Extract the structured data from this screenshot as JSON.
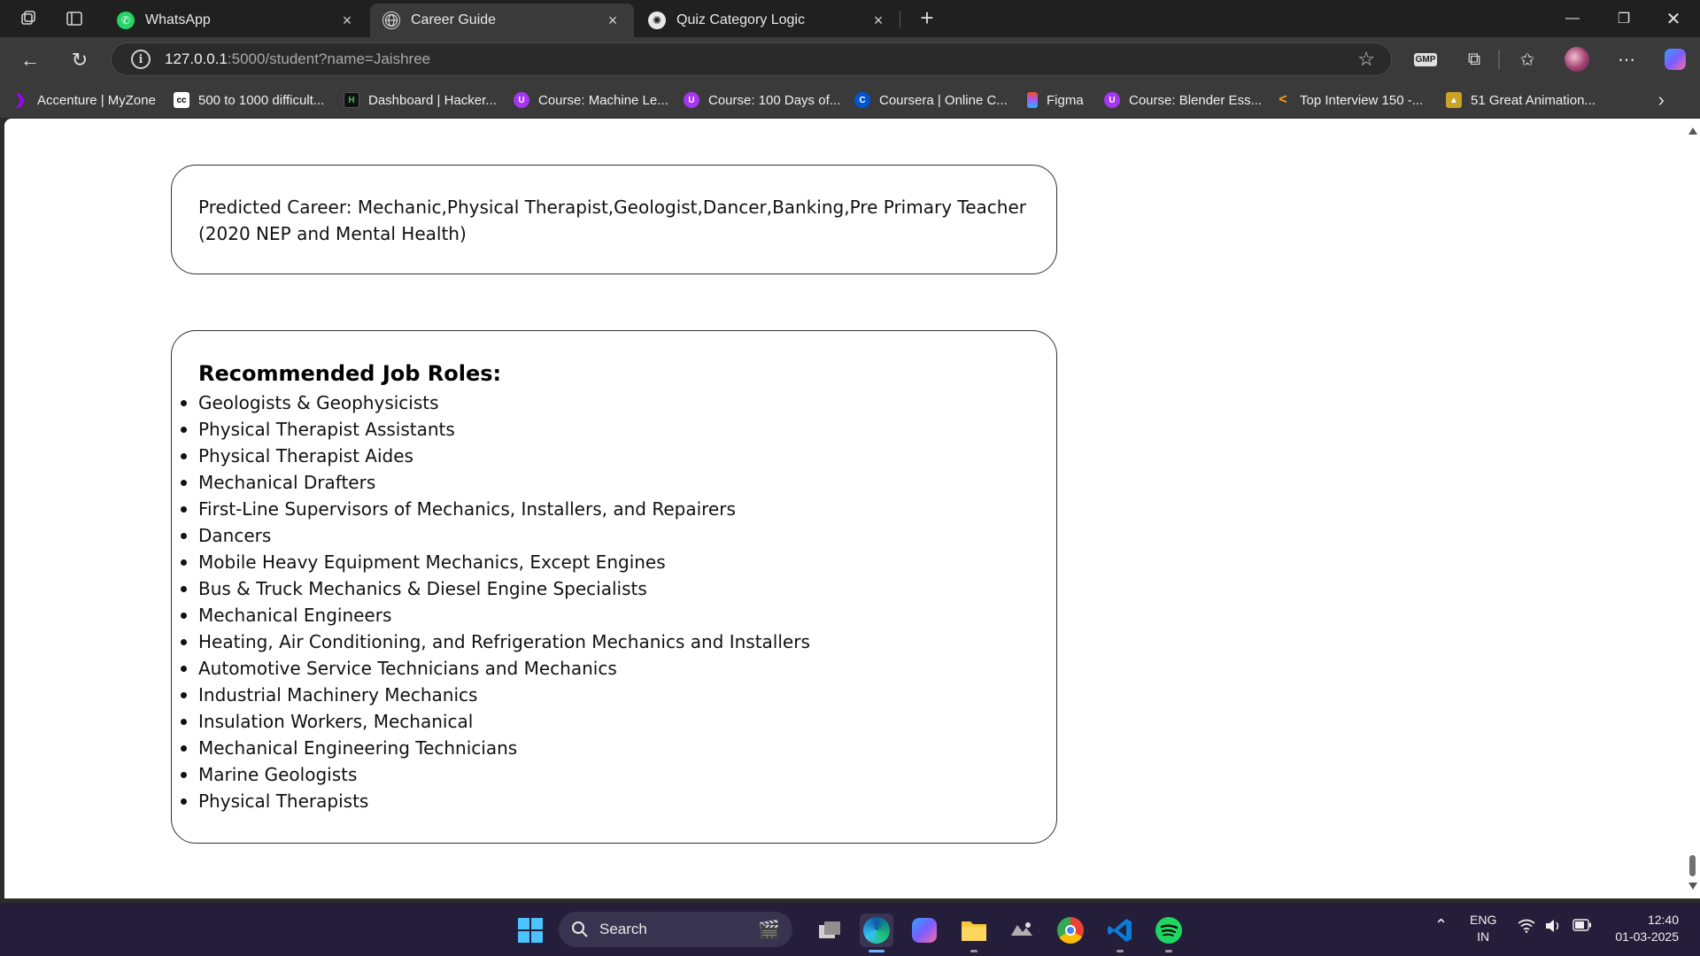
{
  "tabs": [
    {
      "label": "WhatsApp",
      "icon": "whatsapp-icon",
      "active": false
    },
    {
      "label": "Career Guide",
      "icon": "globe-icon",
      "active": true
    },
    {
      "label": "Quiz Category Logic",
      "icon": "chatgpt-icon",
      "active": false
    }
  ],
  "address": {
    "host": "127.0.0.1",
    "rest": ":5000/student?name=Jaishree"
  },
  "toolbar": {
    "gmp_label": "GMP"
  },
  "bookmarks": [
    {
      "label": "Accenture | MyZone",
      "icon": "accenture-icon",
      "color": "#a100ff"
    },
    {
      "label": "500 to 1000 difficult...",
      "icon": "codechef-icon",
      "color": "#000000"
    },
    {
      "label": "Dashboard | Hacker...",
      "icon": "hackerrank-icon",
      "color": "#111111"
    },
    {
      "label": "Course: Machine Le...",
      "icon": "udemy-icon",
      "color": "#a435f0"
    },
    {
      "label": "Course: 100 Days of...",
      "icon": "udemy-icon",
      "color": "#a435f0"
    },
    {
      "label": "Coursera | Online C...",
      "icon": "coursera-icon",
      "color": "#0056d2"
    },
    {
      "label": "Figma",
      "icon": "figma-icon",
      "color": "#f24e1e"
    },
    {
      "label": "Course: Blender Ess...",
      "icon": "udemy-icon",
      "color": "#a435f0"
    },
    {
      "label": "Top Interview 150 -...",
      "icon": "leetcode-icon",
      "color": "#ffa116"
    },
    {
      "label": "51 Great Animation...",
      "icon": "animation-icon",
      "color": "#c9a227"
    }
  ],
  "content": {
    "predicted_career": "Predicted Career: Mechanic,Physical Therapist,Geologist,Dancer,Banking,Pre Primary Teacher (2020 NEP and Mental Health)",
    "recommended_heading": "Recommended Job Roles:",
    "job_roles": [
      "Geologists & Geophysicists",
      "Physical Therapist Assistants",
      "Physical Therapist Aides",
      "Mechanical Drafters",
      "First-Line Supervisors of Mechanics, Installers, and Repairers",
      "Dancers",
      "Mobile Heavy Equipment Mechanics, Except Engines",
      "Bus & Truck Mechanics & Diesel Engine Specialists",
      "Mechanical Engineers",
      "Heating, Air Conditioning, and Refrigeration Mechanics and Installers",
      "Automotive Service Technicians and Mechanics",
      "Industrial Machinery Mechanics",
      "Insulation Workers, Mechanical",
      "Mechanical Engineering Technicians",
      "Marine Geologists",
      "Physical Therapists"
    ]
  },
  "taskbar": {
    "search_label": "Search",
    "lang_top": "ENG",
    "lang_bottom": "IN",
    "time": "12:40",
    "date": "01-03-2025"
  },
  "colors": {
    "browser_frame": "#202020",
    "toolbar": "#3a3a3a",
    "taskbar": "#241e3a",
    "card_border": "#333333"
  }
}
